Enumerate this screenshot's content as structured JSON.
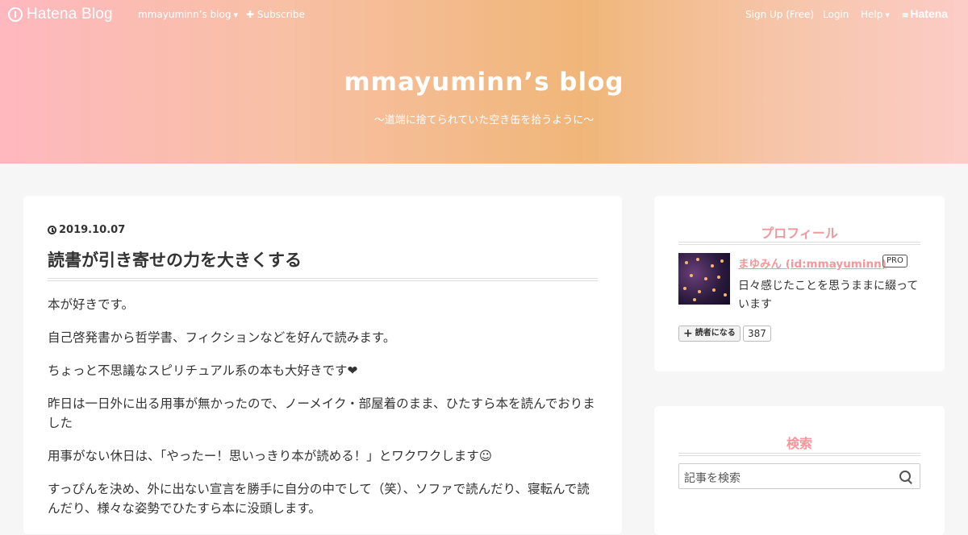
{
  "navbar": {
    "logo": "Hatena Blog",
    "blog_menu": "mmayuminn’s blog",
    "subscribe": "Subscribe",
    "signup": "Sign Up (Free)",
    "login": "Login",
    "help": "Help",
    "brand": "Hatena"
  },
  "header": {
    "title": "mmayuminn’s blog",
    "description": "〜道端に捨てられていた空き缶を拾うように〜"
  },
  "entry": {
    "date": "2019.10.07",
    "title": "読書が引き寄せの力を大きくする",
    "paragraphs": [
      "本が好きです。",
      "自己啓発書から哲学書、フィクションなどを好んで読みます。",
      "ちょっと不思議なスピリチュアル系の本も大好きです❤",
      "昨日は一日外に出る用事が無かったので、ノーメイク・部屋着のまま、ひたすら本を読んでおりました",
      "用事がない休日は、「やったー！思いっきり本が読める！」とワクワクします☺",
      "すっぴんを決め、外に出ない宣言を勝手に自分の中でして（笑）、ソファで読んだり、寝転んで読んだり、様々な姿勢でひたすら本に没頭します。"
    ]
  },
  "profile": {
    "heading": "プロフィール",
    "name": "まゆみん (id:mmayuminn)",
    "badge": "PRO",
    "description": "日々感じたことを思うままに綴っています",
    "subscribe_button": "読者になる",
    "subscriber_count": "387"
  },
  "search": {
    "heading": "検索",
    "placeholder": "記事を検索"
  }
}
